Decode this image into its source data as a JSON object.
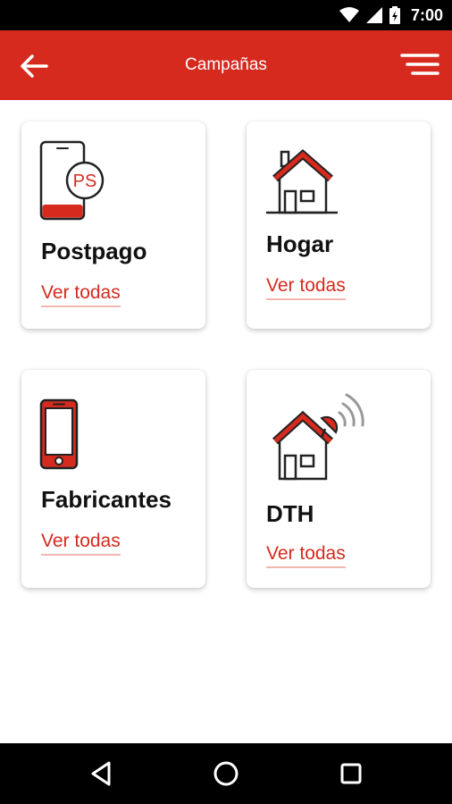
{
  "status_bar": {
    "time": "7:00"
  },
  "app_bar": {
    "title": "Campañas"
  },
  "cards": [
    {
      "title": "Postpago",
      "link": "Ver todas",
      "icon": "phone-ps-icon",
      "badge": "PS"
    },
    {
      "title": "Hogar",
      "link": "Ver todas",
      "icon": "house-icon"
    },
    {
      "title": "Fabricantes",
      "link": "Ver todas",
      "icon": "smartphone-icon"
    },
    {
      "title": "DTH",
      "link": "Ver todas",
      "icon": "house-satellite-icon"
    }
  ],
  "colors": {
    "accent": "#d62a1f",
    "link_underline": "#f3b7b2",
    "text": "#111111"
  }
}
